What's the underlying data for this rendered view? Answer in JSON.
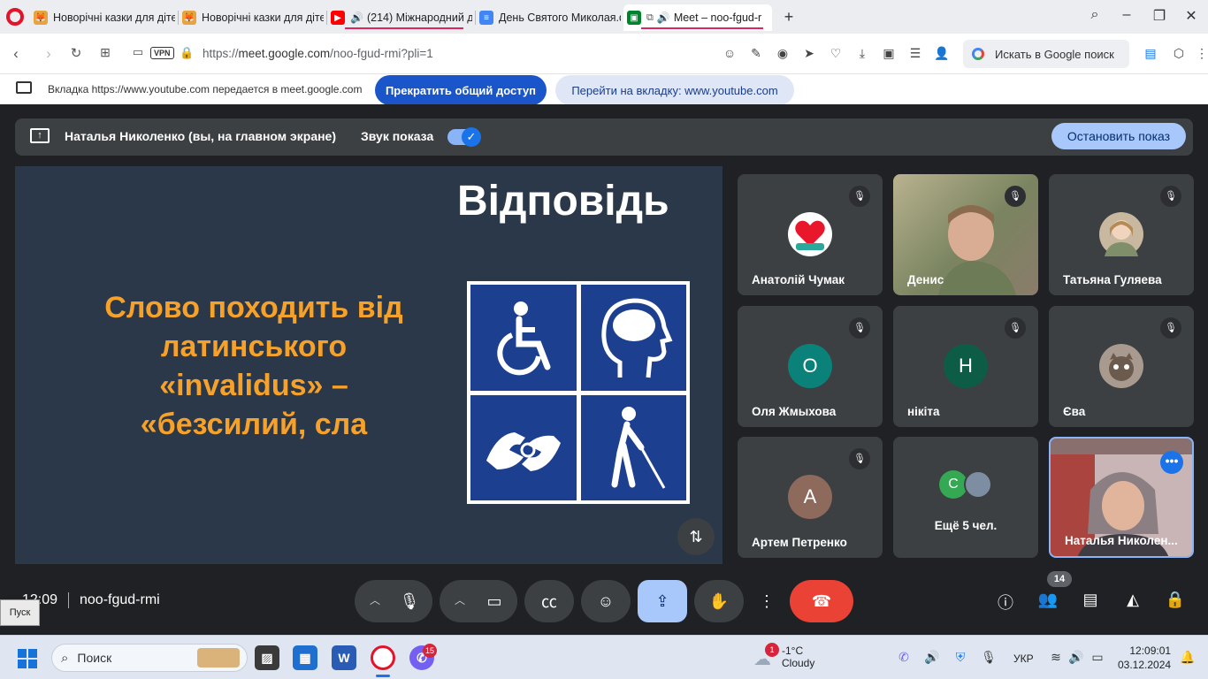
{
  "browser": {
    "tabs": [
      {
        "title": "Новорічні казки для дітей"
      },
      {
        "title": "Новорічні казки для дітей"
      },
      {
        "title": "(214) Міжнародний д"
      },
      {
        "title": "День Святого Миколая.d"
      },
      {
        "title": "Meet – noo-fgud-r"
      }
    ],
    "url_prefix": "https://",
    "url_host": "meet.google.com",
    "url_path": "/noo-fgud-rmi?pli=1",
    "vpn_label": "VPN",
    "search_placeholder": "Искать в Google поиск"
  },
  "sharebar": {
    "info": "Вкладка https://www.youtube.com передается в meet.google.com",
    "stop_sharing": "Прекратить общий доступ",
    "go_to_tab": "Перейти на вкладку: www.youtube.com"
  },
  "presentation": {
    "presenter_label": "Наталья Николенко (вы, на главном экране)",
    "sound_label": "Звук показа",
    "sound_on": true,
    "stop_button": "Остановить показ"
  },
  "slide": {
    "title": "Відповідь",
    "lines": [
      "Слово походить від",
      "латинського",
      "«invalidus» –",
      "«безсилий, сла"
    ]
  },
  "participants": [
    {
      "name": "Анатолій Чумак",
      "initial": "",
      "color": "#ffffff",
      "muted": true
    },
    {
      "name": "Денис",
      "initial": "",
      "color": "",
      "muted": true
    },
    {
      "name": "Татьяна Гуляева",
      "initial": "",
      "color": "#c9b8a0",
      "muted": true
    },
    {
      "name": "Оля Жмыхова",
      "initial": "О",
      "color": "#0b8279",
      "muted": true
    },
    {
      "name": "нікіта",
      "initial": "Н",
      "color": "#0d5c46",
      "muted": true
    },
    {
      "name": "Єва",
      "initial": "",
      "color": "#a89a8e",
      "muted": true
    },
    {
      "name": "Артем Петренко",
      "initial": "А",
      "color": "#8d6a5c",
      "muted": true
    },
    {
      "name": "Наталья Николен...",
      "initial": "",
      "color": "",
      "muted": false
    }
  ],
  "more_people": {
    "label": "Ещё 5 чел.",
    "initial": "С"
  },
  "controls": {
    "time": "12:09",
    "meeting_code": "noo-fgud-rmi",
    "people_count": "14"
  },
  "tooltip": "Пуск",
  "taskbar": {
    "search_label": "Поиск",
    "viber_badge": "15",
    "weather_badge": "1",
    "temperature": "-1°C",
    "weather": "Cloudy",
    "language": "УКР",
    "time": "12:09:01",
    "date": "03.12.2024"
  }
}
